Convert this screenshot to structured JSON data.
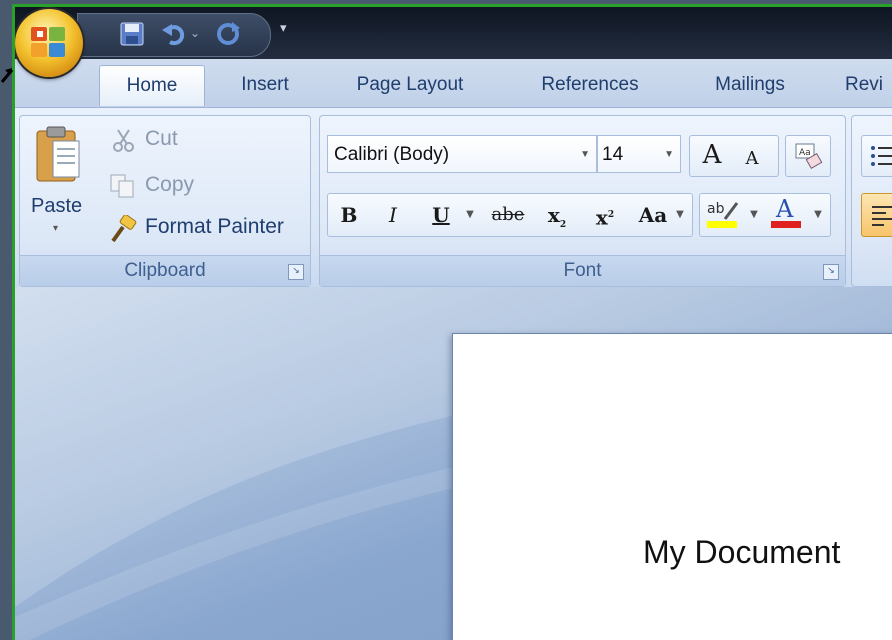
{
  "quick_access": {
    "icons": [
      "office-button-icon",
      "save-icon",
      "undo-icon",
      "undo-dropdown-icon",
      "redo-icon",
      "customize-qat-icon"
    ],
    "customize_glyph": "▾"
  },
  "tabs": [
    {
      "label": "Home",
      "active": true
    },
    {
      "label": "Insert"
    },
    {
      "label": "Page Layout"
    },
    {
      "label": "References"
    },
    {
      "label": "Mailings"
    },
    {
      "label": "Revi"
    }
  ],
  "clipboard": {
    "group_label": "Clipboard",
    "paste_label": "Paste",
    "cut_label": "Cut",
    "copy_label": "Copy",
    "format_painter_label": "Format Painter"
  },
  "font": {
    "group_label": "Font",
    "font_name": "Calibri (Body)",
    "font_size": "14",
    "bold": "B",
    "italic": "I",
    "underline": "U",
    "strikethrough": "abe",
    "subscript": "x",
    "superscript": "x",
    "change_case": "Aa",
    "grow_font": "A",
    "shrink_font": "A",
    "highlight_color": "#ffff00",
    "font_color": "#e02020"
  },
  "document": {
    "text": "My Document"
  },
  "colors": {
    "frame_border": "#2aa02a",
    "title_bar": "#1b2434",
    "ribbon": "#dbe6f5",
    "tab_text": "#1f3e6e"
  }
}
